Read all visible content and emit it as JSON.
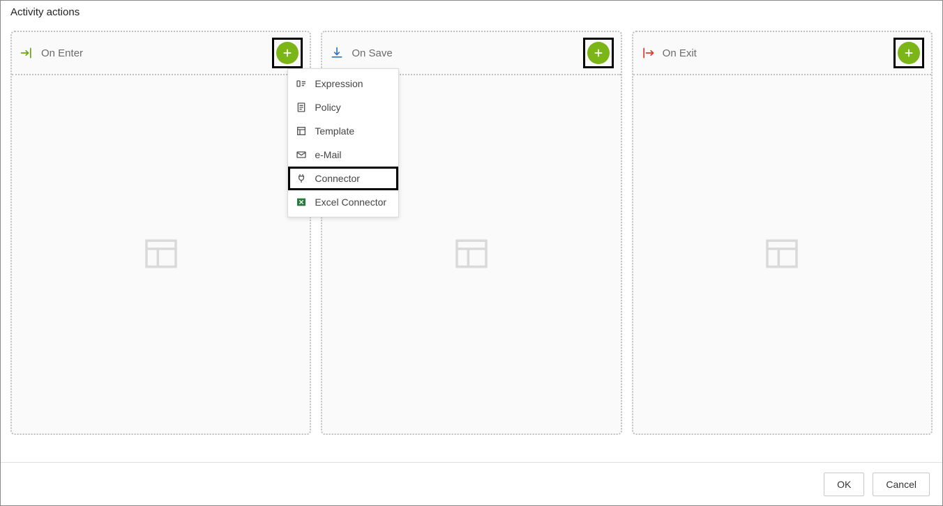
{
  "dialog": {
    "title": "Activity actions"
  },
  "panels": {
    "enter": {
      "title": "On Enter"
    },
    "save": {
      "title": "On Save"
    },
    "exit": {
      "title": "On Exit"
    }
  },
  "dropdown": {
    "items": {
      "expression": "Expression",
      "policy": "Policy",
      "template": "Template",
      "email": "e-Mail",
      "connector": "Connector",
      "excel": "Excel Connector"
    }
  },
  "footer": {
    "ok": "OK",
    "cancel": "Cancel"
  },
  "colors": {
    "accent_green": "#7cb518",
    "exit_red": "#d93a2b",
    "save_blue": "#2f74c0",
    "enter_green": "#6aa514"
  }
}
